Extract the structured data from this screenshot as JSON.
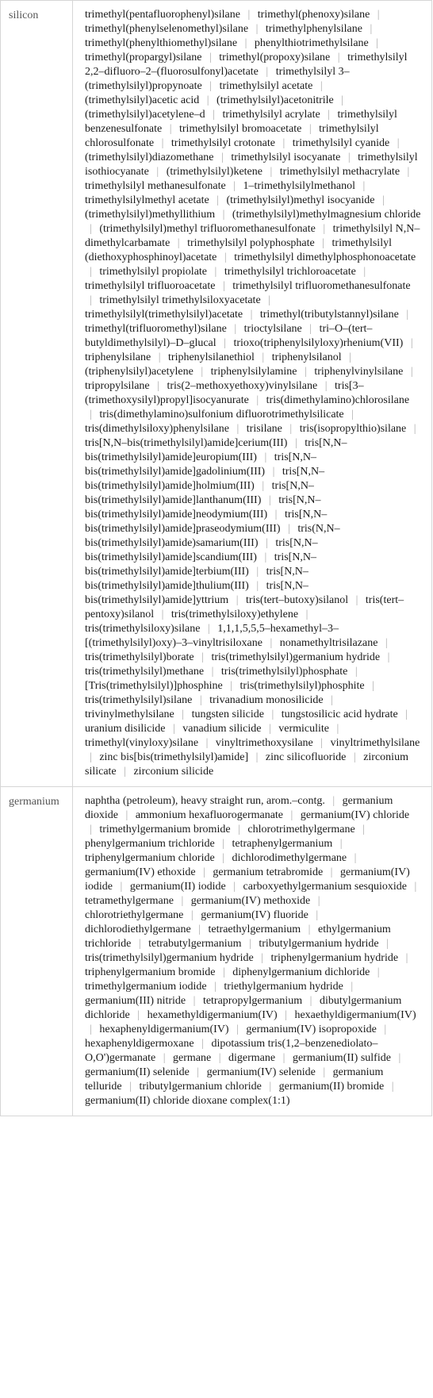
{
  "rows": [
    {
      "element": "silicon",
      "compounds": [
        "trimethyl(pentafluorophenyl)silane",
        "trimethyl(phenoxy)silane",
        "trimethyl(phenylselenomethyl)silane",
        "trimethylphenylsilane",
        "trimethyl(phenylthiomethyl)silane",
        "phenylthiotrimethylsilane",
        "trimethyl(propargyl)silane",
        "trimethyl(propoxy)silane",
        "trimethylsilyl 2,2–difluoro–2–(fluorosulfonyl)acetate",
        "trimethylsilyl 3–(trimethylsilyl)propynoate",
        "trimethylsilyl acetate",
        "(trimethylsilyl)acetic acid",
        "(trimethylsilyl)acetonitrile",
        "(trimethylsilyl)acetylene–d",
        "trimethylsilyl acrylate",
        "trimethylsilyl benzenesulfonate",
        "trimethylsilyl bromoacetate",
        "trimethylsilyl chlorosulfonate",
        "trimethylsilyl crotonate",
        "trimethylsilyl cyanide",
        "(trimethylsilyl)diazomethane",
        "trimethylsilyl isocyanate",
        "trimethylsilyl isothiocyanate",
        "(trimethylsilyl)ketene",
        "trimethylsilyl methacrylate",
        "trimethylsilyl methanesulfonate",
        "1–trimethylsilylmethanol",
        "trimethylsilylmethyl acetate",
        "(trimethylsilyl)methyl isocyanide",
        "(trimethylsilyl)methyllithium",
        "(trimethylsilyl)methylmagnesium chloride",
        "(trimethylsilyl)methyl trifluoromethanesulfonate",
        "trimethylsilyl N,N–dimethylcarbamate",
        "trimethylsilyl polyphosphate",
        "trimethylsilyl (diethoxyphosphinoyl)acetate",
        "trimethylsilyl dimethylphosphonoacetate",
        "trimethylsilyl propiolate",
        "trimethylsilyl trichloroacetate",
        "trimethylsilyl trifluoroacetate",
        "trimethylsilyl trifluoromethanesulfonate",
        "trimethylsilyl trimethylsiloxyacetate",
        "trimethylsilyl(trimethylsilyl)acetate",
        "trimethyl(tributylstannyl)silane",
        "trimethyl(trifluoromethyl)silane",
        "trioctylsilane",
        "tri–O–(tert–butyldimethylsilyl)–D–glucal",
        "trioxo(triphenylsilyloxy)rhenium(VII)",
        "triphenylsilane",
        "triphenylsilanethiol",
        "triphenylsilanol",
        "(triphenylsilyl)acetylene",
        "triphenylsilylamine",
        "triphenylvinylsilane",
        "tripropylsilane",
        "tris(2–methoxyethoxy)vinylsilane",
        "tris[3–(trimethoxysilyl)propyl]isocyanurate",
        "tris(dimethylamino)chlorosilane",
        "tris(dimethylamino)sulfonium difluorotrimethylsilicate",
        "tris(dimethylsiloxy)phenylsilane",
        "trisilane",
        "tris(isopropylthio)silane",
        "tris[N,N–bis(trimethylsilyl)amide]cerium(III)",
        "tris[N,N–bis(trimethylsilyl)amide]europium(III)",
        "tris[N,N–bis(trimethylsilyl)amide]gadolinium(III)",
        "tris[N,N–bis(trimethylsilyl)amide]holmium(III)",
        "tris[N,N–bis(trimethylsilyl)amide]lanthanum(III)",
        "tris[N,N–bis(trimethylsilyl)amide]neodymium(III)",
        "tris[N,N–bis(trimethylsilyl)amide]praseodymium(III)",
        "tris(N,N–bis(trimethylsilyl)amide)samarium(III)",
        "tris[N,N–bis(trimethylsilyl)amide]scandium(III)",
        "tris[N,N–bis(trimethylsilyl)amide]terbium(III)",
        "tris[N,N–bis(trimethylsilyl)amide]thulium(III)",
        "tris[N,N–bis(trimethylsilyl)amide]yttrium",
        "tris(tert–butoxy)silanol",
        "tris(tert–pentoxy)silanol",
        "tris(trimethylsiloxy)ethylene",
        "tris(trimethylsiloxy)silane",
        "1,1,1,5,5,5–hexamethyl–3–[(trimethylsilyl)oxy)–3–vinyltrisiloxane",
        "nonamethyltrisilazane",
        "tris(trimethylsilyl)borate",
        "tris(trimethylsilyl)germanium hydride",
        "tris(trimethylsilyl)methane",
        "tris(trimethylsilyl)phosphate",
        "[Tris(trimethylsilyl)]phosphine",
        "tris(trimethylsilyl)phosphite",
        "tris(trimethylsilyl)silane",
        "trivanadium monosilicide",
        "trivinylmethylsilane",
        "tungsten silicide",
        "tungstosilicic acid hydrate",
        "uranium disilicide",
        "vanadium silicide",
        "vermiculite",
        "trimethyl(vinyloxy)silane",
        "vinyltrimethoxysilane",
        "vinyltrimethylsilane",
        "zinc bis[bis(trimethylsilyl)amide]",
        "zinc silicofluoride",
        "zirconium silicate",
        "zirconium silicide"
      ]
    },
    {
      "element": "germanium",
      "compounds": [
        "naphtha (petroleum), heavy straight run, arom.–contg.",
        "germanium dioxide",
        "ammonium hexafluorogermanate",
        "germanium(IV) chloride",
        "trimethylgermanium bromide",
        "chlorotrimethylgermane",
        "phenylgermanium trichloride",
        "tetraphenylgermanium",
        "triphenylgermanium chloride",
        "dichlorodimethylgermane",
        "germanium(IV) ethoxide",
        "germanium tetrabromide",
        "germanium(IV) iodide",
        "germanium(II) iodide",
        "carboxyethylgermanium sesquioxide",
        "tetramethylgermane",
        "germanium(IV) methoxide",
        "chlorotriethylgermane",
        "germanium(IV) fluoride",
        "dichlorodiethylgermane",
        "tetraethylgermanium",
        "ethylgermanium trichloride",
        "tetrabutylgermanium",
        "tributylgermanium hydride",
        "tris(trimethylsilyl)germanium hydride",
        "triphenylgermanium hydride",
        "triphenylgermanium bromide",
        "diphenylgermanium dichloride",
        "trimethylgermanium iodide",
        "triethylgermanium hydride",
        "germanium(III) nitride",
        "tetrapropylgermanium",
        "dibutylgermanium dichloride",
        "hexamethyldigermanium(IV)",
        "hexaethyldigermanium(IV)",
        "hexaphenyldigermanium(IV)",
        "germanium(IV) isopropoxide",
        "hexaphenyldigermoxane",
        "dipotassium tris(1,2–benzenediolato–O,O')germanate",
        "germane",
        "digermane",
        "germanium(II) sulfide",
        "germanium(II) selenide",
        "germanium(IV) selenide",
        "germanium telluride",
        "tributylgermanium chloride",
        "germanium(II) bromide",
        "germanium(II) chloride dioxane complex(1:1)"
      ]
    }
  ],
  "separator": "|"
}
